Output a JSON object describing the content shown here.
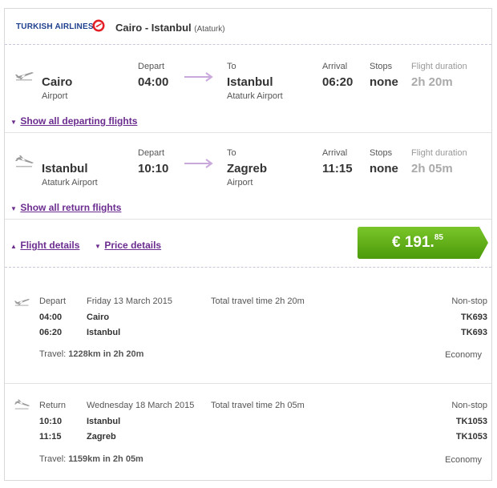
{
  "header": {
    "airline": "TURKISH AIRLINES",
    "route": "Cairo - Istanbul",
    "route_sub": "(Ataturk)"
  },
  "outbound": {
    "from_city": "Cairo",
    "from_airport": "Airport",
    "depart_label": "Depart",
    "depart_time": "04:00",
    "to_label": "To",
    "to_city": "Istanbul",
    "to_airport": "Ataturk Airport",
    "arrival_label": "Arrival",
    "arrival_time": "06:20",
    "stops_label": "Stops",
    "stops": "none",
    "duration_label": "Flight duration",
    "duration": "2h 20m",
    "show_all": "Show all departing flights"
  },
  "return": {
    "from_city": "Istanbul",
    "from_airport": "Ataturk Airport",
    "depart_label": "Depart",
    "depart_time": "10:10",
    "to_label": "To",
    "to_city": "Zagreb",
    "to_airport": "Airport",
    "arrival_label": "Arrival",
    "arrival_time": "11:15",
    "stops_label": "Stops",
    "stops": "none",
    "duration_label": "Flight duration",
    "duration": "2h 05m",
    "show_all": "Show all return flights"
  },
  "actions": {
    "flight_details": "Flight details",
    "price_details": "Price details",
    "price_main": "€ 191.",
    "price_cents": "85"
  },
  "details_out": {
    "label": "Depart",
    "date": "Friday 13 March 2015",
    "total": "Total travel time 2h 20m",
    "type": "Non-stop",
    "t1": "04:00",
    "c1": "Cairo",
    "f1": "TK693",
    "t2": "06:20",
    "c2": "Istanbul",
    "f2": "TK693",
    "travel_prefix": "Travel:",
    "travel_value": "1228km in 2h 20m",
    "class": "Economy"
  },
  "details_ret": {
    "label": "Return",
    "date": "Wednesday 18 March 2015",
    "total": "Total travel time 2h 05m",
    "type": "Non-stop",
    "t1": "10:10",
    "c1": "Istanbul",
    "f1": "TK1053",
    "t2": "11:15",
    "c2": "Zagreb",
    "f2": "TK1053",
    "travel_prefix": "Travel:",
    "travel_value": "1159km in 2h 05m",
    "class": "Economy"
  },
  "colors": {
    "link": "#6b2c8f",
    "price_green": "#5aa90f",
    "arrow": "#c9a8dc",
    "brand_red": "#e31e24",
    "brand_blue": "#1f3f8f"
  }
}
